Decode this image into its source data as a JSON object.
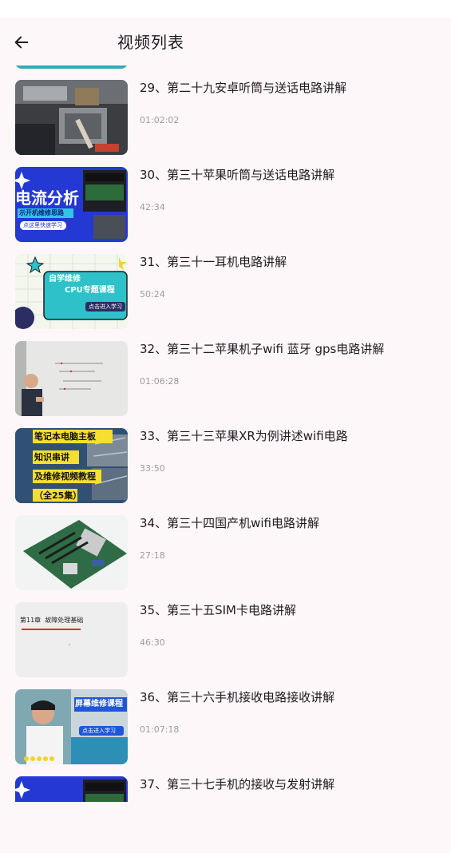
{
  "header": {
    "title": "视频列表",
    "back_icon": "arrow-left-icon"
  },
  "videos": [
    {
      "title": "29、第二十九安卓听筒与送话电路讲解",
      "duration": "01:02:02",
      "thumb": "motherboard-soldering"
    },
    {
      "title": "30、第三十苹果听筒与送话电路讲解",
      "duration": "42:34",
      "thumb": "current-analysis-promo",
      "thumb_text": [
        "电流分析",
        "示开机维修思路",
        "点这里快速学习"
      ]
    },
    {
      "title": "31、第三十一耳机电路讲解",
      "duration": "50:24",
      "thumb": "cpu-course-promo",
      "thumb_text": [
        "自学维修",
        "CPU专题课程",
        "点击进入学习"
      ]
    },
    {
      "title": "32、第三十二苹果机子wifi 蓝牙 gps电路讲解",
      "duration": "01:06:28",
      "thumb": "whiteboard-lecture"
    },
    {
      "title": "33、第三十三苹果XR为例讲述wifi电路",
      "duration": "33:50",
      "thumb": "laptop-board-course",
      "thumb_text": [
        "笔记本电脑主板",
        "知识串讲",
        "及维修视频教程",
        "（全25集）"
      ]
    },
    {
      "title": "34、第三十四国产机wifi电路讲解",
      "duration": "27:18",
      "thumb": "pc-motherboard"
    },
    {
      "title": "35、第三十五SIM卡电路讲解",
      "duration": "46:30",
      "thumb": "slide-chapter",
      "thumb_text": [
        "第11章",
        "故障处理基础"
      ]
    },
    {
      "title": "36、第三十六手机接收电路接收讲解",
      "duration": "01:07:18",
      "thumb": "screen-repair-course",
      "thumb_text": [
        "屏幕维修课程",
        "点击进入学习"
      ]
    },
    {
      "title": "37、第三十七手机的接收与发射讲解",
      "duration": "",
      "thumb": "current-analysis-promo"
    }
  ],
  "colors": {
    "background": "#fdf7fa",
    "text": "#1f1b1e",
    "muted": "#9e9a9c",
    "accent_blue": "#1f3fd6",
    "accent_teal": "#35aab8"
  }
}
